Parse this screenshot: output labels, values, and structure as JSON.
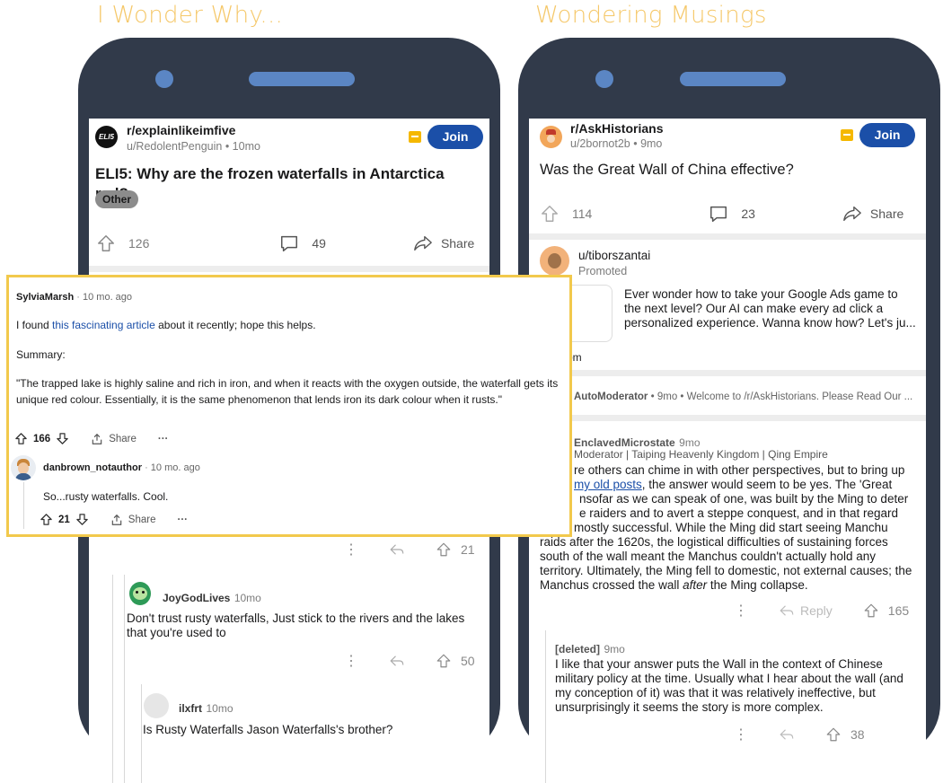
{
  "captions": {
    "left": "I Wonder Why...",
    "right": "Wondering Musings"
  },
  "left_post": {
    "subreddit": "r/explainlikeimfive",
    "avatar_text": "ELI5",
    "author": "u/RedolentPenguin",
    "age": "10mo",
    "join_label": "Join",
    "title": "ELI5: Why are the frozen waterfalls in Antarctica red?",
    "flair": "Other",
    "upvotes": "126",
    "comments": "49",
    "share_label": "Share"
  },
  "left_comments": [
    {
      "score": "21"
    },
    {
      "user": "JoyGodLives",
      "age": "10mo",
      "text": "Don't trust rusty waterfalls, Just stick to the rivers and the lakes that you're used to",
      "score": "50"
    },
    {
      "user": "ilxfrt",
      "age": "10mo",
      "text": "Is Rusty Waterfalls Jason Waterfalls's brother?"
    }
  ],
  "overlay": {
    "user": "SylviaMarsh",
    "age": "10 mo. ago",
    "intro_before": "I found ",
    "intro_link": "this fascinating article",
    "intro_after": " about it recently; hope this helps.",
    "summary_label": "Summary:",
    "quote": "\"The trapped lake is highly saline and rich in iron, and when it reacts with the oxygen outside, the waterfall gets its unique red colour. Essentially, it is the same phenomenon that lends iron its dark colour when it rusts.\"",
    "score": "166",
    "share_label": "Share",
    "more": "···",
    "reply": {
      "user": "danbrown_notauthor",
      "age": "10 mo. ago",
      "text": "So...rusty waterfalls. Cool.",
      "score": "21",
      "share_label": "Share",
      "more": "···"
    }
  },
  "right_post": {
    "subreddit": "r/AskHistorians",
    "author": "u/2bornot2b",
    "age": "9mo",
    "join_label": "Join",
    "title": "Was the Great Wall of China effective?",
    "upvotes": "114",
    "comments": "23",
    "share_label": "Share"
  },
  "ad": {
    "user": "u/tiborszantai",
    "promoted": "Promoted",
    "text": "Ever wonder how to take your Google Ads game to the next level? Our AI can make every ad click a personalized experience. Wanna know how? Let's ju...",
    "domain": "nk.com"
  },
  "automod": {
    "user": "AutoModerator",
    "meta": "• 9mo • Welcome to /r/AskHistorians. Please Read Our ..."
  },
  "answer": {
    "user": "EnclavedMicrostate",
    "age": "9mo",
    "flair": "Moderator | Taiping Heavenly Kingdom | Qing Empire",
    "line1": "re others can chime in with other perspectives, but to bring up",
    "line2_link": "my old posts",
    "line2_rest": ", the answer would seem to be yes. The 'Great",
    "line3": "nsofar as we can speak of one, was built by the Ming to deter",
    "line4": "e raiders and to avert a steppe conquest, and in that regard",
    "line5": "mostly successful. While the Ming did start seeing Manchu",
    "rest": "raids after the 1620s, the logistical difficulties of sustaining forces south of the wall meant the Manchus couldn't actually hold any territory. Ultimately, the Ming fell to domestic, not external causes; the Manchus crossed the wall",
    "after_em": "after",
    "end": "the Ming collapse.",
    "reply_label": "Reply",
    "score": "165"
  },
  "deleted": {
    "user": "[deleted]",
    "age": "9mo",
    "text": "I like that your answer puts the Wall in the context of Chinese military policy at the time. Usually what I hear about the wall (and my conception of it) was that it was relatively ineffective, but unsurprisingly it seems the story is more complex.",
    "score": "38"
  },
  "colors": {
    "accent": "#1b4fa8",
    "caption": "#f5c86a",
    "phone": "#313a4a",
    "highlight": "#f2c94c"
  }
}
